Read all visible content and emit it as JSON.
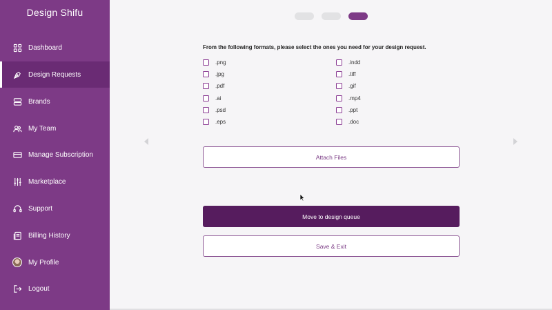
{
  "sidebar": {
    "brand": "Design Shifu",
    "items": [
      {
        "label": "Dashboard",
        "icon": "grid-icon"
      },
      {
        "label": "Design Requests",
        "icon": "pen-tool-icon"
      },
      {
        "label": "Brands",
        "icon": "server-icon"
      },
      {
        "label": "My Team",
        "icon": "users-icon"
      },
      {
        "label": "Manage Subscription",
        "icon": "credit-card-icon"
      },
      {
        "label": "Marketplace",
        "icon": "sliders-icon"
      },
      {
        "label": "Support",
        "icon": "headset-icon"
      },
      {
        "label": "Billing History",
        "icon": "receipt-icon"
      },
      {
        "label": "My Profile",
        "icon": "avatar"
      },
      {
        "label": "Logout",
        "icon": "logout-icon"
      }
    ],
    "active_item": "Design Requests"
  },
  "steps": {
    "total": 3,
    "current": 3
  },
  "form": {
    "question": "From the following formats, please select the ones you need for your design request.",
    "formats_left": [
      ".png",
      ".jpg",
      ".pdf",
      ".ai",
      ".psd",
      ".eps"
    ],
    "formats_right": [
      ".indd",
      ".tiff",
      ".gif",
      ".mp4",
      ".ppt",
      ".doc"
    ]
  },
  "buttons": {
    "attach": "Attach Files",
    "move": "Move to design queue",
    "save_exit": "Save & Exit"
  },
  "colors": {
    "sidebar": "#7d3a86",
    "sidebar_active": "#6a2b74",
    "primary_button": "#561c5e",
    "accent": "#8a3b93"
  }
}
